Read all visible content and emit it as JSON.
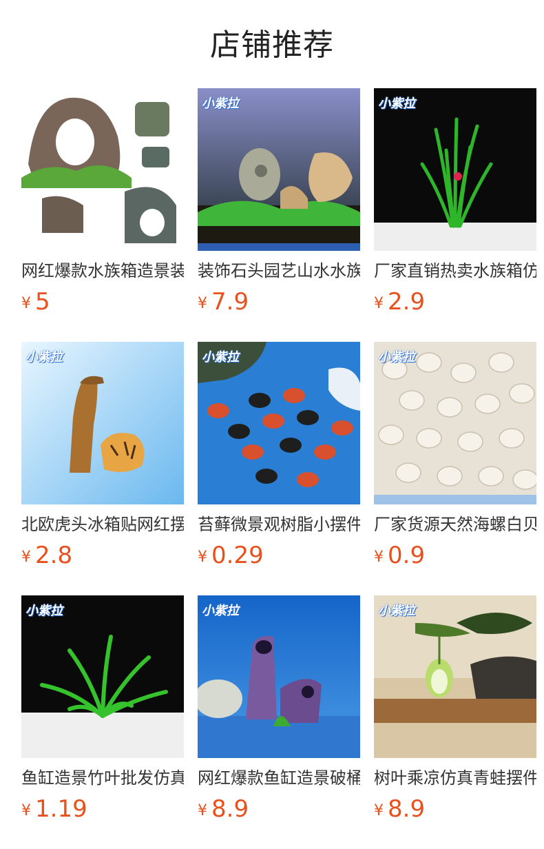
{
  "page": {
    "title": "店铺推荐"
  },
  "brand_logo": "小紫拉",
  "currency": "¥",
  "products": [
    {
      "name": "网红爆款水族箱造景装饰",
      "price": "5",
      "logo": false
    },
    {
      "name": "装饰石头园艺山水水族",
      "price": "7.9",
      "logo": true
    },
    {
      "name": "厂家直销热卖水族箱仿真",
      "price": "2.9",
      "logo": true
    },
    {
      "name": "北欧虎头冰箱贴网红摆件",
      "price": "2.8",
      "logo": true
    },
    {
      "name": "苔藓微景观树脂小摆件",
      "price": "0.29",
      "logo": true
    },
    {
      "name": "厂家货源天然海螺白贝壳",
      "price": "0.9",
      "logo": true
    },
    {
      "name": "鱼缸造景竹叶批发仿真",
      "price": "1.19",
      "logo": true
    },
    {
      "name": "网红爆款鱼缸造景破桶",
      "price": "8.9",
      "logo": true
    },
    {
      "name": "树叶乘凉仿真青蛙摆件",
      "price": "8.9",
      "logo": true
    }
  ]
}
